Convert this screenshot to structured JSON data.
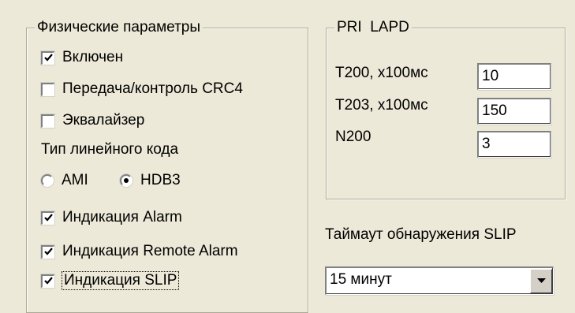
{
  "physical": {
    "title": "Физические параметры",
    "enabled": {
      "label": "Включен",
      "checked": true
    },
    "crc4": {
      "label": "Передача/контроль CRC4",
      "checked": false
    },
    "equalizer": {
      "label": "Эквалайзер",
      "checked": false
    },
    "line_code_label": "Тип линейного кода",
    "line_code_options": [
      {
        "label": "AMI",
        "selected": false
      },
      {
        "label": "HDB3",
        "selected": true
      }
    ],
    "alarm": {
      "label": "Индикация Alarm",
      "checked": true
    },
    "remote_alarm": {
      "label": "Индикация Remote Alarm",
      "checked": true
    },
    "slip": {
      "label": "Индикация SLIP",
      "checked": true
    }
  },
  "lapd": {
    "title": "PRI  LAPD",
    "t200": {
      "label": "T200, x100мс",
      "value": "10"
    },
    "t203": {
      "label": "T203, x100мс",
      "value": "150"
    },
    "n200": {
      "label": "N200",
      "value": "3"
    }
  },
  "slip_timeout": {
    "label": "Таймаут обнаружения SLIP",
    "value": "15 минут"
  }
}
